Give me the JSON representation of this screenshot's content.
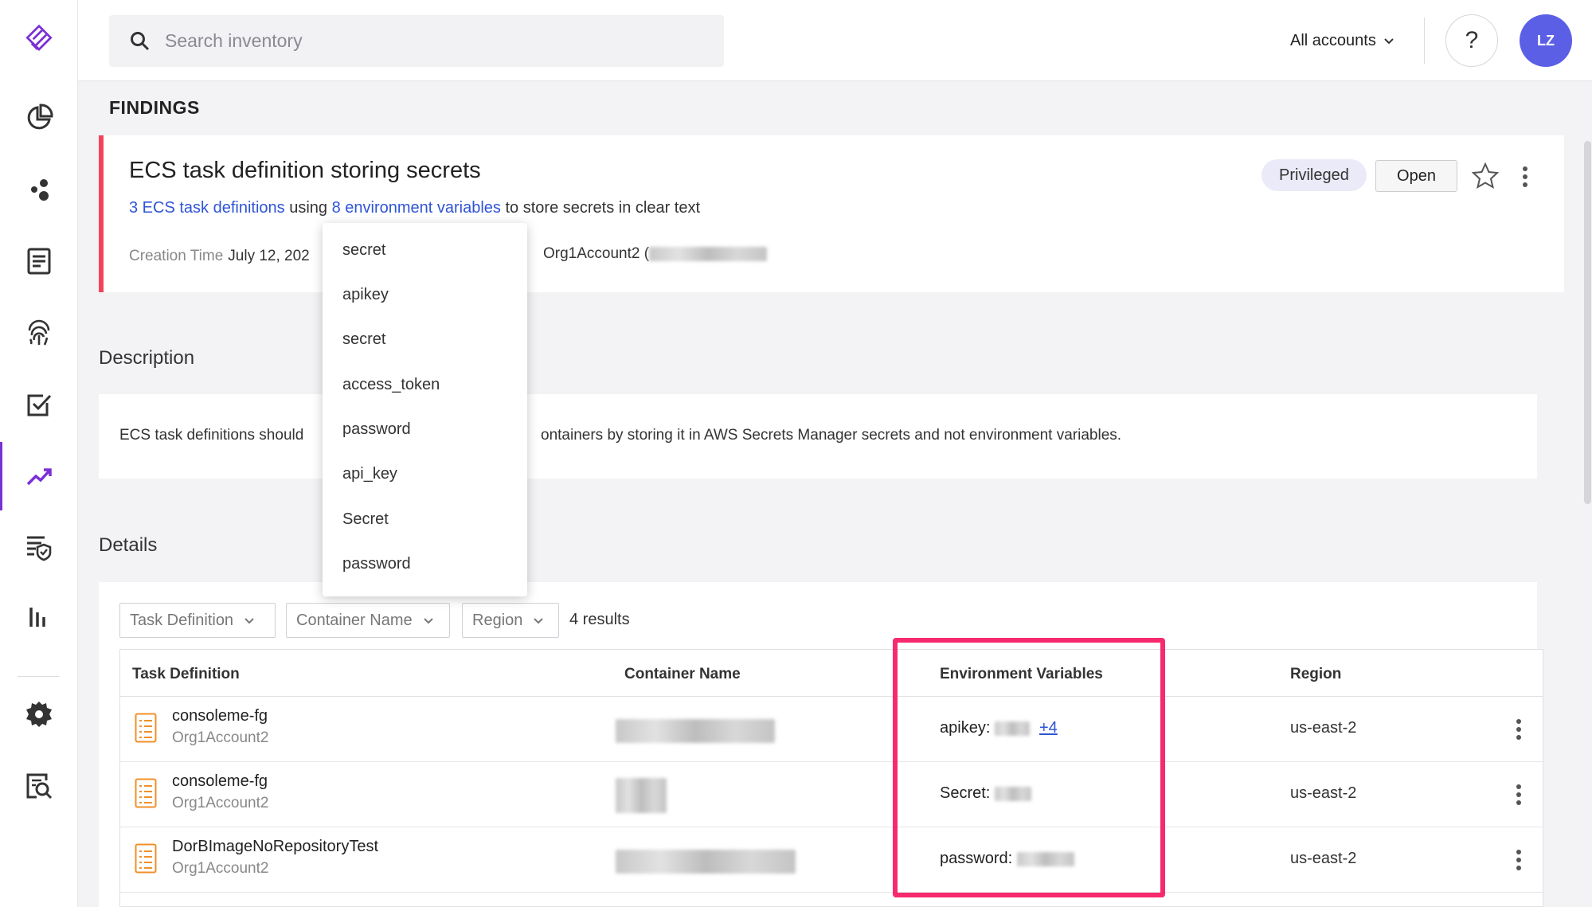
{
  "search": {
    "placeholder": "Search inventory"
  },
  "header": {
    "accounts_label": "All accounts",
    "help_label": "?",
    "avatar_initials": "LZ"
  },
  "page": {
    "title": "FINDINGS"
  },
  "finding": {
    "title": "ECS task definition storing secrets",
    "subtitle": {
      "link1": "3 ECS task definitions",
      "text1": " using ",
      "link2": "8 environment variables",
      "text2": " to store secrets in clear text"
    },
    "creation_label": "Creation Time",
    "creation_value": "July 12, 202",
    "account_value": "Org1Account2 (",
    "badge": "Privileged",
    "status_button": "Open"
  },
  "env_dropdown": {
    "items": [
      "secret",
      "apikey",
      "secret",
      "access_token",
      "password",
      "api_key",
      "Secret",
      "password"
    ]
  },
  "description": {
    "heading": "Description",
    "text_start": "ECS task definitions should",
    "text_end": "ontainers by storing it in AWS Secrets Manager secrets and not environment variables."
  },
  "details": {
    "heading": "Details",
    "filters": [
      "Task Definition",
      "Container Name",
      "Region"
    ],
    "results": "4 results",
    "columns": [
      "Task Definition",
      "Container Name",
      "Environment Variables",
      "Region"
    ],
    "rows": [
      {
        "task": "consoleme-fg",
        "account": "Org1Account2",
        "env": "apikey: ",
        "more": "+4",
        "region": "us-east-2"
      },
      {
        "task": "consoleme-fg",
        "account": "Org1Account2",
        "env": "Secret: ",
        "more": "",
        "region": "us-east-2"
      },
      {
        "task": "DorBImageNoRepositoryTest",
        "account": "Org1Account2",
        "env": "password: ",
        "more": "",
        "region": "us-east-2"
      }
    ]
  },
  "colors": {
    "accent": "#7b2fd6",
    "link": "#2f54d6",
    "severity": "#f0445a",
    "highlight": "#f72a6e",
    "avatar": "#5b5fe6"
  }
}
